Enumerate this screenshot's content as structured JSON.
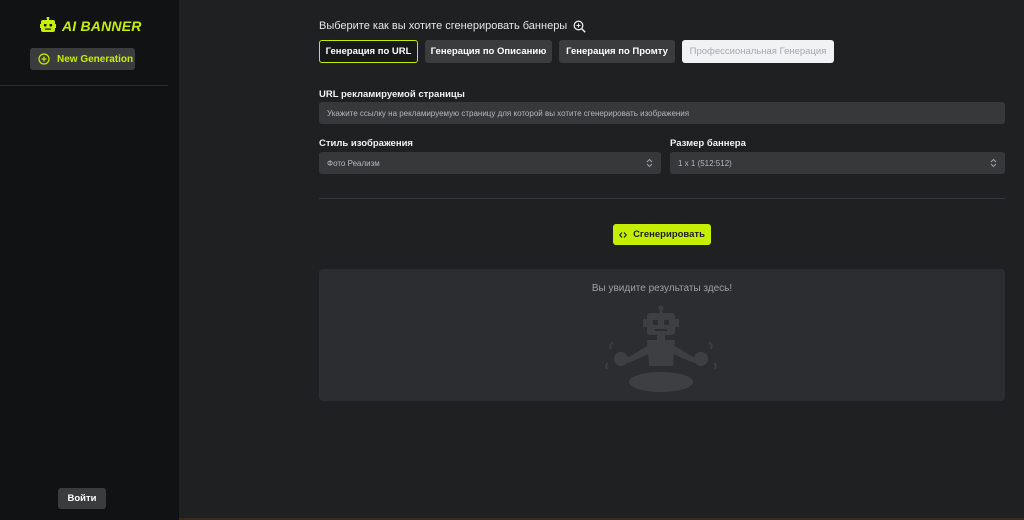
{
  "sidebar": {
    "logo_text": "AI BANNER",
    "new_generation_label": "New Generation",
    "login_label": "Войти"
  },
  "main": {
    "heading": "Выберите как вы хотите сгенерировать баннеры",
    "modes": [
      {
        "label": "Генерация по URL",
        "state": "active"
      },
      {
        "label": "Генерация по Описанию",
        "state": "default"
      },
      {
        "label": "Генерация по Промту",
        "state": "default"
      },
      {
        "label": "Профессиональная Генерация",
        "state": "disabled"
      }
    ],
    "url_label": "URL рекламируемой страницы",
    "url_placeholder": "Укажите ссылку на рекламируемую страницу для которой вы хотите сгенерировать изображения",
    "style_label": "Стиль изображения",
    "style_value": "Фото Реализм",
    "size_label": "Размер баннера",
    "size_value": "1 x 1 (512:512)",
    "generate_label": "Сгенерировать",
    "results_placeholder": "Вы увидите результаты здесь!"
  },
  "colors": {
    "accent": "#c4f000",
    "sidebar_bg": "#111213",
    "main_bg": "#1f2022",
    "button_bg": "#3a3c3e",
    "input_bg": "#36383a",
    "results_bg": "#2c2d30"
  },
  "icons": {
    "logo": "robot-icon",
    "new_generation": "plus-circle-icon",
    "heading": "search-zoom-icon",
    "generate": "code-arrows-icon",
    "select": "chevron-up-down-icon",
    "results": "meditating-robot-icon"
  }
}
